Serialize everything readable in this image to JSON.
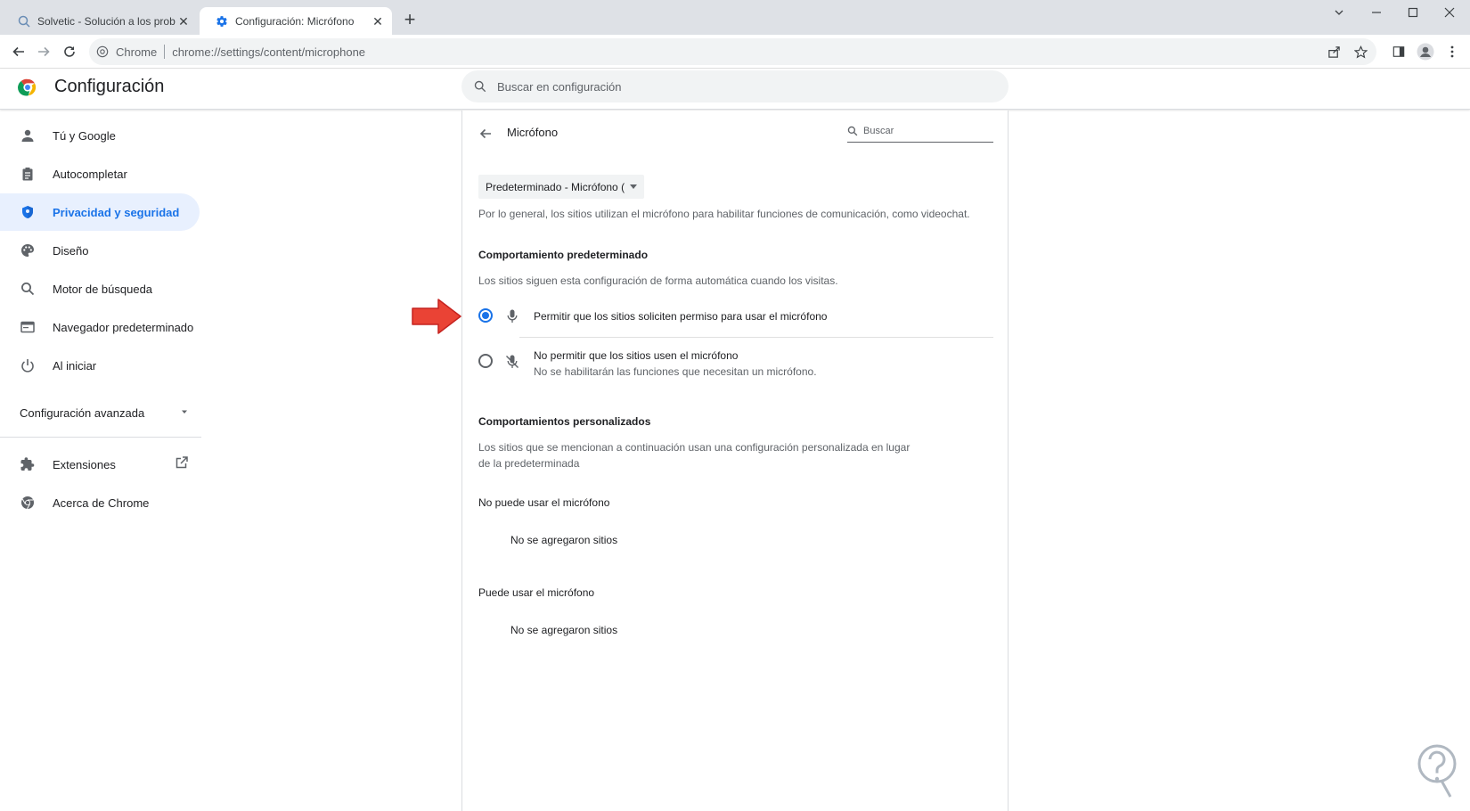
{
  "browser": {
    "tabs": [
      {
        "title": "Solvetic - Solución a los problem",
        "icon": "magnifier-favicon"
      },
      {
        "title": "Configuración: Micrófono",
        "icon": "gear-favicon"
      }
    ],
    "site_chip": "Chrome",
    "url": "chrome://settings/content/microphone"
  },
  "settings": {
    "title": "Configuración",
    "search_placeholder": "Buscar en configuración"
  },
  "sidebar": {
    "items": [
      {
        "label": "Tú y Google",
        "icon": "person-icon"
      },
      {
        "label": "Autocompletar",
        "icon": "clipboard-icon"
      },
      {
        "label": "Privacidad y seguridad",
        "icon": "shield-icon"
      },
      {
        "label": "Diseño",
        "icon": "palette-icon"
      },
      {
        "label": "Motor de búsqueda",
        "icon": "search-icon"
      },
      {
        "label": "Navegador predeterminado",
        "icon": "browser-icon"
      },
      {
        "label": "Al iniciar",
        "icon": "power-icon"
      }
    ],
    "advanced_label": "Configuración avanzada",
    "extensions_label": "Extensiones",
    "about_label": "Acerca de Chrome"
  },
  "main": {
    "page_title": "Micrófono",
    "search_placeholder": "Buscar",
    "device_select": "Predeterminado - Micrófono (",
    "intro": "Por lo general, los sitios utilizan el micrófono para habilitar funciones de comunicación, como videochat.",
    "default_heading": "Comportamiento predeterminado",
    "default_desc": "Los sitios siguen esta configuración de forma automática cuando los visitas.",
    "option_allow": "Permitir que los sitios soliciten permiso para usar el micrófono",
    "option_block": "No permitir que los sitios usen el micrófono",
    "option_block_sub": "No se habilitarán las funciones que necesitan un micrófono.",
    "custom_heading": "Comportamientos personalizados",
    "custom_desc": "Los sitios que se mencionan a continuación usan una configuración personalizada en lugar de la predeterminada",
    "blocked_heading": "No puede usar el micrófono",
    "blocked_empty": "No se agregaron sitios",
    "allowed_heading": "Puede usar el micrófono",
    "allowed_empty": "No se agregaron sitios"
  },
  "colors": {
    "accent": "#1a73e8",
    "active_bg": "#e8f0fe",
    "arrow": "#ea4335"
  }
}
